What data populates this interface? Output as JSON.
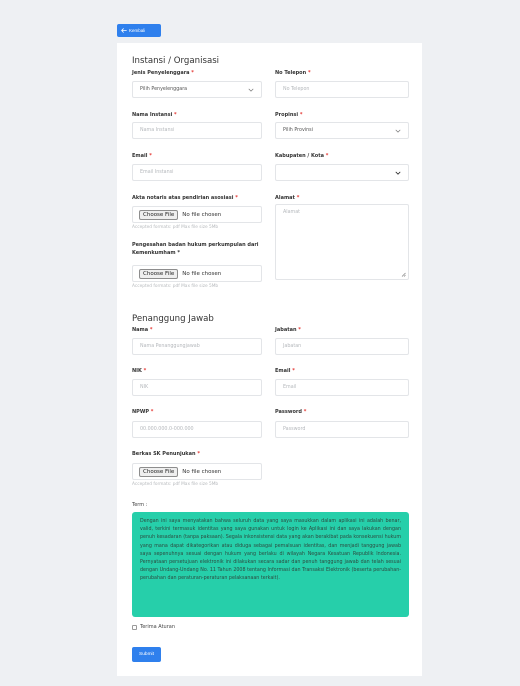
{
  "back_button": {
    "label": "Kembali",
    "icon": "arrow-left-icon"
  },
  "instansi": {
    "title": "Instansi / Organisasi",
    "jenis": {
      "label": "Jenis Penyelenggara",
      "value": "Pilih Penyelenggara"
    },
    "telepon": {
      "label": "No Telepon",
      "placeholder": "No Telepon"
    },
    "nama": {
      "label": "Nama Instansi",
      "placeholder": "Nama Instansi"
    },
    "propinsi": {
      "label": "Propinsi",
      "value": "Pilih Provinsi"
    },
    "email": {
      "label": "Email",
      "placeholder": "Email Instansi"
    },
    "kabupaten": {
      "label": "Kabupaten / Kota",
      "value": ""
    },
    "akta": {
      "label": "Akta notaris atas pendirian asosiasi",
      "button": "Choose File",
      "status": "No file chosen",
      "hint": "Accepted formats: pdf Max file size 5Mb"
    },
    "alamat": {
      "label": "Alamat",
      "placeholder": "Alamat"
    },
    "pengesahan": {
      "label": "Pengesahan badan hukum perkumpulan dari Kemenkumham",
      "button": "Choose File",
      "status": "No file chosen",
      "hint": "Accepted formats: pdf Max file size 5Mb"
    }
  },
  "penanggung": {
    "title": "Penanggung Jawab",
    "nama": {
      "label": "Nama",
      "placeholder": "Nama Penanggungjawab"
    },
    "jabatan": {
      "label": "Jabatan",
      "placeholder": "Jabatan"
    },
    "nik": {
      "label": "NIK",
      "placeholder": "NIK"
    },
    "email": {
      "label": "Email",
      "placeholder": "Email"
    },
    "npwp": {
      "label": "NPWP",
      "placeholder": "00.000.000.0-000.000"
    },
    "password": {
      "label": "Password",
      "placeholder": "Password"
    },
    "sk": {
      "label": "Berkas SK Penunjukan",
      "button": "Choose File",
      "status": "No file chosen",
      "hint": "Accepted formats: pdf Max file size 5Mb"
    }
  },
  "term": {
    "label": "Term :",
    "text": "Dengan ini saya menyatakan bahwa seluruh data yang saya masukkan dalam aplikasi ini adalah benar, valid, terkini termasuk identitas yang saya gunakan untuk login ke Aplikasi ini dan saya lakukan dengan penuh kesadaran (tanpa paksaan). Segala inkonsistensi data yang akan berakibat pada konsekuensi hukum yang mana dapat dikategorikan atau diduga sebagai pemalsuan identitas, dan menjadi tanggung jawab saya sepenuhnya sesuai dengan hukum yang berlaku di wilayah Negara Kesatuan Republik Indonesia. Pernyataan persetujuan elektronik ini dilakukan secara sadar dan penuh tanggung jawab dan telah sesuai dengan Undang-Undang No. 11 Tahun 2008 tentang Informasi dan Transaksi Elektronik (beserta perubahan-perubahan dan peraturan-peraturan pelaksanaan terkait)."
  },
  "agree": {
    "label": "Terima Aturan"
  },
  "submit": {
    "label": "Submit"
  },
  "required_mark": "*"
}
